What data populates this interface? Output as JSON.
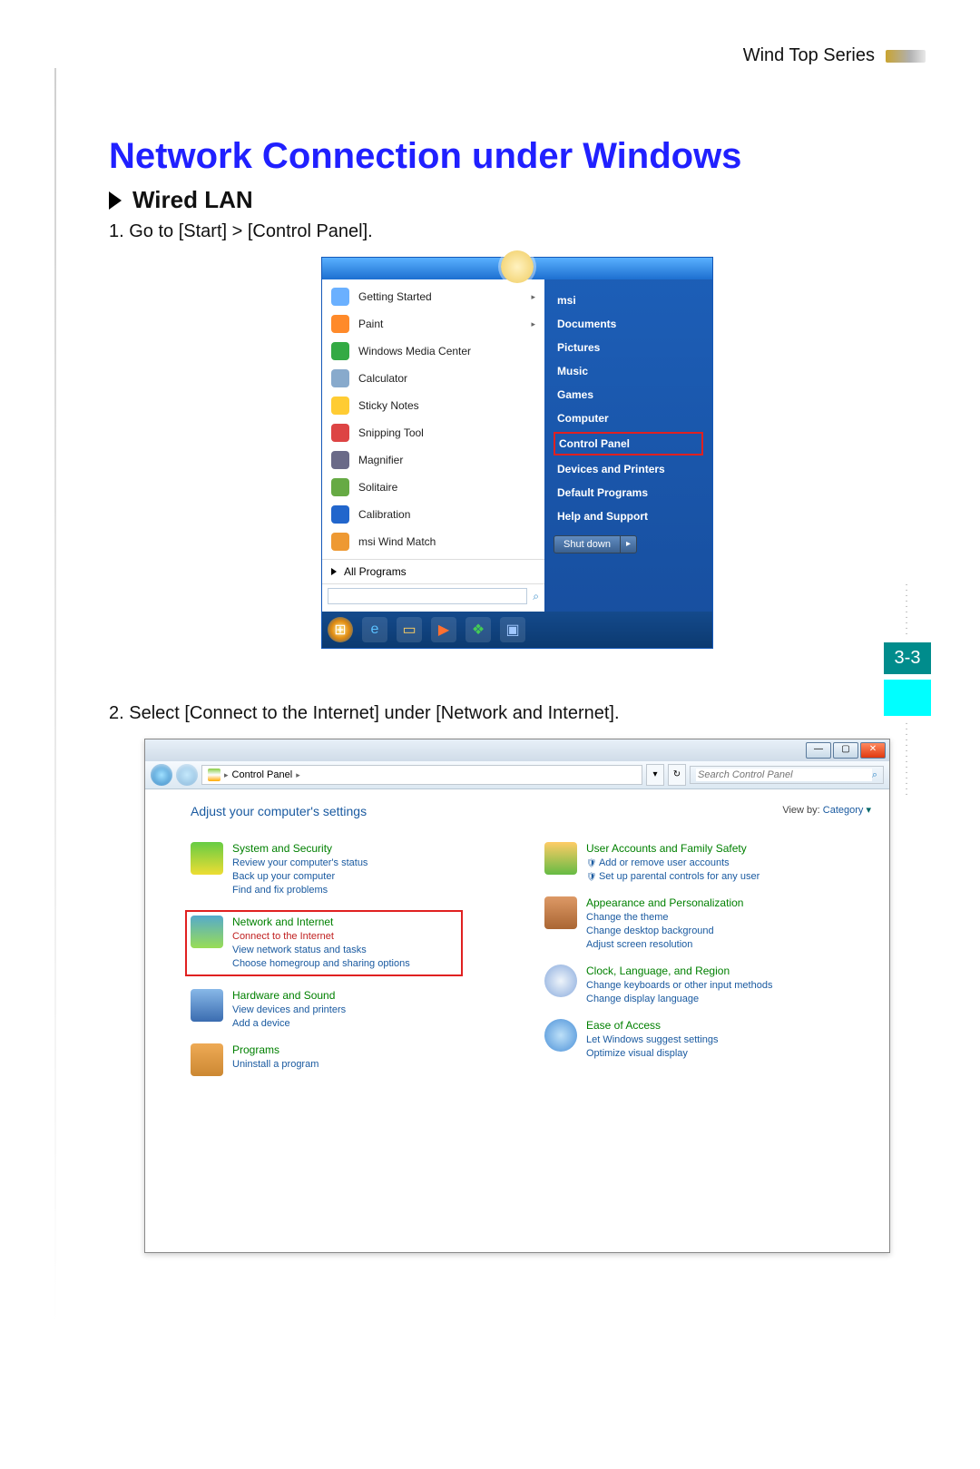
{
  "header": {
    "series": "Wind Top Series"
  },
  "title": "Network Connection under Windows",
  "subsection": "Wired LAN",
  "steps": [
    "1. Go to [Start] > [Control Panel].",
    "2. Select [Connect to the Internet] under [Network and Internet]."
  ],
  "page_number": "3-3",
  "start_menu": {
    "left_items": [
      {
        "label": "Getting Started",
        "submenu": true,
        "color": "#6ab0ff"
      },
      {
        "label": "Paint",
        "submenu": true,
        "color": "#ff8a2a"
      },
      {
        "label": "Windows Media Center",
        "color": "#33aa44"
      },
      {
        "label": "Calculator",
        "color": "#88aacc"
      },
      {
        "label": "Sticky Notes",
        "color": "#ffcc33"
      },
      {
        "label": "Snipping Tool",
        "color": "#dd4444"
      },
      {
        "label": "Magnifier",
        "color": "#6a6a88"
      },
      {
        "label": "Solitaire",
        "color": "#66aa44"
      },
      {
        "label": "Calibration",
        "color": "#2266cc"
      },
      {
        "label": "msi Wind Match",
        "color": "#ee9933"
      }
    ],
    "all_programs": "All Programs",
    "search_placeholder": "",
    "right_items": [
      {
        "label": "msi"
      },
      {
        "label": "Documents"
      },
      {
        "label": "Pictures"
      },
      {
        "label": "Music"
      },
      {
        "label": "Games"
      },
      {
        "label": "Computer"
      },
      {
        "label": "Control Panel",
        "highlight": true
      },
      {
        "label": "Devices and Printers"
      },
      {
        "label": "Default Programs"
      },
      {
        "label": "Help and Support"
      }
    ],
    "shutdown": "Shut down"
  },
  "control_panel": {
    "breadcrumb": "Control Panel",
    "search_placeholder": "Search Control Panel",
    "adjust_label": "Adjust your computer's settings",
    "view_by_label": "View by:",
    "view_by_value": "Category",
    "left_categories": [
      {
        "title": "System and Security",
        "icon": "ic-sec",
        "links": [
          "Review your computer's status",
          "Back up your computer",
          "Find and fix problems"
        ]
      },
      {
        "title": "Network and Internet",
        "icon": "ic-net",
        "highlight": true,
        "links": [
          "Connect to the Internet",
          "View network status and tasks",
          "Choose homegroup and sharing options"
        ]
      },
      {
        "title": "Hardware and Sound",
        "icon": "ic-hw",
        "links": [
          "View devices and printers",
          "Add a device"
        ]
      },
      {
        "title": "Programs",
        "icon": "ic-prog",
        "links": [
          "Uninstall a program"
        ]
      }
    ],
    "right_categories": [
      {
        "title": "User Accounts and Family Safety",
        "icon": "ic-user",
        "links": [
          "Add or remove user accounts",
          "Set up parental controls for any user"
        ],
        "sublinks": true
      },
      {
        "title": "Appearance and Personalization",
        "icon": "ic-app",
        "links": [
          "Change the theme",
          "Change desktop background",
          "Adjust screen resolution"
        ]
      },
      {
        "title": "Clock, Language, and Region",
        "icon": "ic-clk",
        "links": [
          "Change keyboards or other input methods",
          "Change display language"
        ]
      },
      {
        "title": "Ease of Access",
        "icon": "ic-ease",
        "links": [
          "Let Windows suggest settings",
          "Optimize visual display"
        ]
      }
    ]
  }
}
